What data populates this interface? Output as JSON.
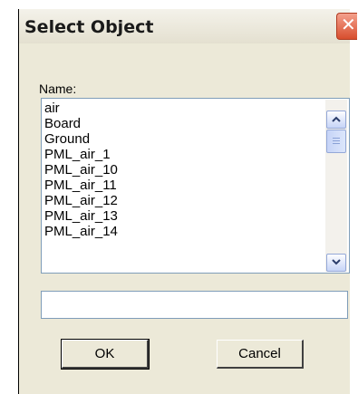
{
  "window": {
    "title": "Select Object",
    "close_icon": "close-icon"
  },
  "form": {
    "name_label": "Name:",
    "list_items": [
      "air",
      "Board",
      "Ground",
      "PML_air_1",
      "PML_air_10",
      "PML_air_11",
      "PML_air_12",
      "PML_air_13",
      "PML_air_14"
    ],
    "text_value": "",
    "scrollbar_icons": [
      "chevron-up-icon",
      "chevron-down-icon"
    ]
  },
  "buttons": {
    "ok_label": "OK",
    "cancel_label": "Cancel"
  }
}
